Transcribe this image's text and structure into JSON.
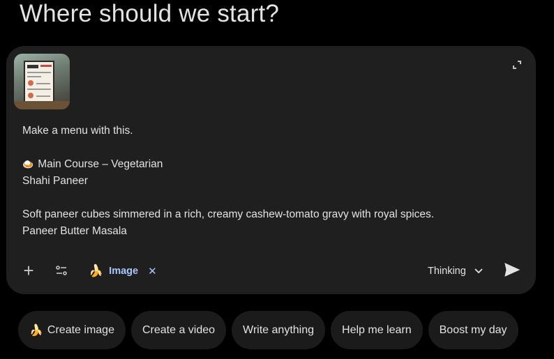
{
  "header": {
    "title": "Where should we start?"
  },
  "composer": {
    "prompt_lines": [
      "Make a menu with this.",
      "",
      "Main Course – Vegetarian",
      "Shahi Paneer",
      "",
      "Soft paneer cubes simmered in a rich, creamy cashew-tomato gravy with royal spices.",
      "Paneer Butter Masala"
    ],
    "curry_emoji": "🍛",
    "tool_chip": {
      "emoji": "🍌",
      "label": "Image",
      "remove": "✕"
    },
    "mode": {
      "label": "Thinking"
    }
  },
  "suggestions": [
    {
      "emoji": "🍌",
      "label": "Create image"
    },
    {
      "emoji": "",
      "label": "Create a video"
    },
    {
      "emoji": "",
      "label": "Write anything"
    },
    {
      "emoji": "",
      "label": "Help me learn"
    },
    {
      "emoji": "",
      "label": "Boost my day"
    }
  ],
  "colors": {
    "background": "#000000",
    "composer": "#1f1f1f",
    "accent": "#a8c7fa",
    "text": "#e3e3e3"
  }
}
